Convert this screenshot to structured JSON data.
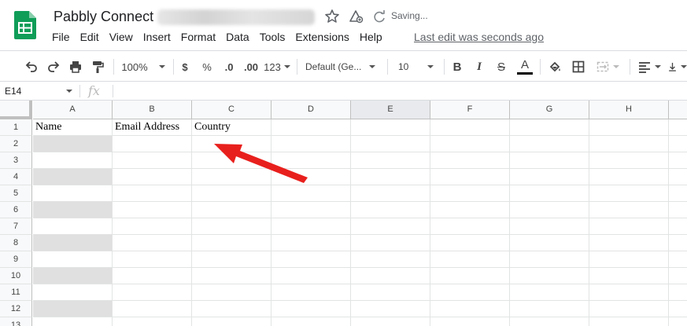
{
  "title_bar": {
    "title": "Pabbly Connect",
    "saving_status": "Saving...",
    "menu": [
      "File",
      "Edit",
      "View",
      "Insert",
      "Format",
      "Data",
      "Tools",
      "Extensions",
      "Help"
    ],
    "last_edit": "Last edit was seconds ago"
  },
  "toolbar": {
    "zoom": "100%",
    "currency": "$",
    "percent": "%",
    "decrease_decimal": ".0",
    "increase_decimal": ".00",
    "number_format": "123",
    "font": "Default (Ge...",
    "font_size": "10",
    "bold": "B",
    "italic": "I",
    "strike": "S",
    "text_color_letter": "A",
    "text_color": "#000000"
  },
  "formula_bar": {
    "name_box": "E14",
    "fx": "fx"
  },
  "grid": {
    "columns": [
      "A",
      "B",
      "C",
      "D",
      "E",
      "F",
      "G",
      "H"
    ],
    "rows": [
      "1",
      "2",
      "3",
      "4",
      "5",
      "6",
      "7",
      "8",
      "9",
      "10",
      "11",
      "12",
      "13"
    ],
    "selected_column": "E",
    "header_row": [
      "Name",
      "Email Address",
      "Country"
    ],
    "shaded_rows_col_a": [
      "2",
      "4",
      "6",
      "8",
      "10",
      "12"
    ]
  },
  "colors": {
    "accent_green": "#0f9d58",
    "arrow_red": "#e8201d",
    "shade_gray": "#e0e0e0"
  }
}
